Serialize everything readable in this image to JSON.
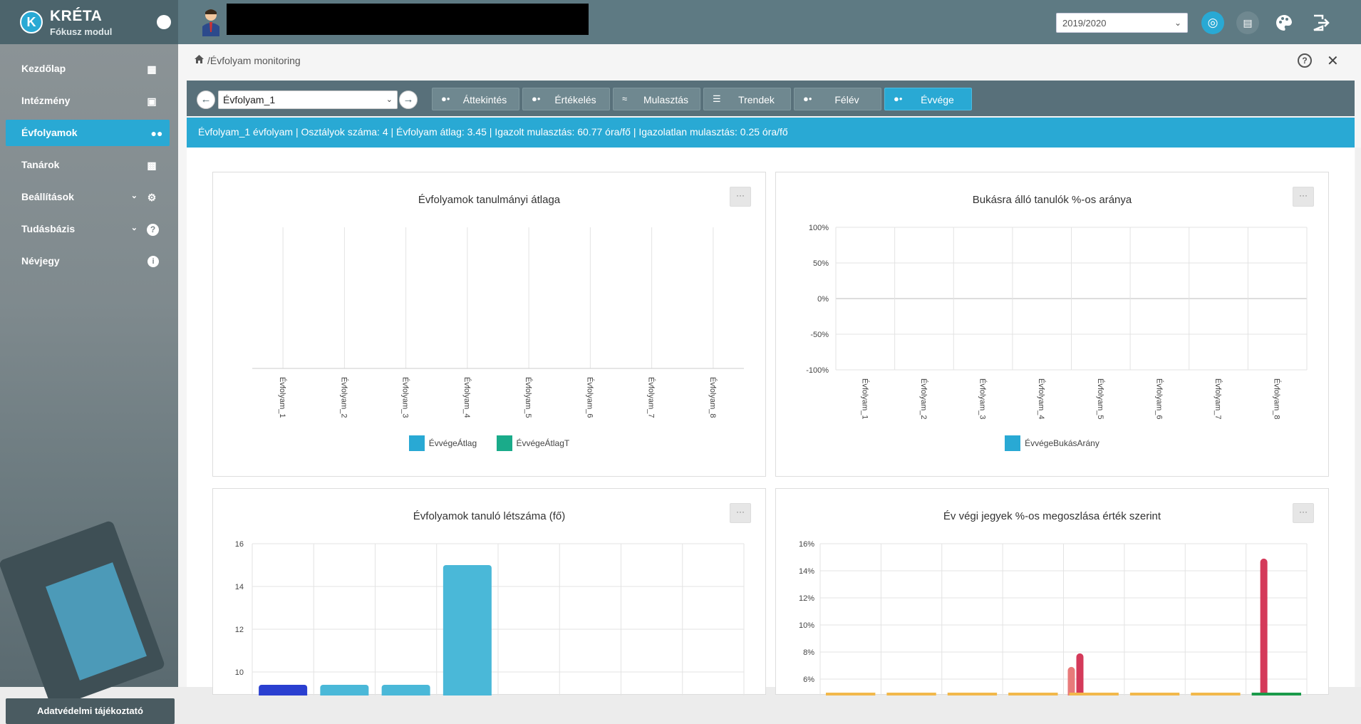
{
  "app": {
    "logo_letter": "K",
    "name": "KRÉTA",
    "module": "Fókusz modul"
  },
  "topbar": {
    "school_year": "2019/2020",
    "icons": [
      "eye-icon",
      "card-icon",
      "palette-icon",
      "logout-icon"
    ]
  },
  "sidebar": {
    "items": [
      {
        "label": "Kezdőlap",
        "icon": "dashboard-icon"
      },
      {
        "label": "Intézmény",
        "icon": "building-icon"
      },
      {
        "label": "Évfolyamok",
        "icon": "group-icon"
      },
      {
        "label": "Tanárok",
        "icon": "contact-card-icon"
      },
      {
        "label": "Beállítások",
        "icon": "gear-icon"
      },
      {
        "label": "Tudásbázis",
        "icon": "help-icon"
      },
      {
        "label": "Névjegy",
        "icon": "info-icon"
      }
    ],
    "privacy_label": "Adatvédelmi tájékoztató"
  },
  "breadcrumb": {
    "separator": "/",
    "current": "Évfolyam monitoring"
  },
  "toolbar": {
    "selected_grade": "Évfolyam_1",
    "tabs": [
      {
        "label": "Áttekintés"
      },
      {
        "label": "Értékelés"
      },
      {
        "label": "Mulasztás"
      },
      {
        "label": "Trendek"
      },
      {
        "label": "Félév"
      },
      {
        "label": "Évvége"
      }
    ],
    "active_tab": "Évvége"
  },
  "infobar": {
    "text": "Évfolyam_1 évfolyam | Osztályok száma: 4 | Évfolyam átlag: 3.45 | Igazolt mulasztás: 60.77 óra/fő | Igazolatlan mulasztás: 0.25 óra/fő"
  },
  "colors": {
    "accent": "#29a9d4",
    "teal": "#1aab8a",
    "bar_blue": "#4ab8d8",
    "pink": "#e05a78",
    "red": "#d43a5a",
    "orange": "#f2b84b"
  },
  "chart_data": [
    {
      "type": "bar",
      "title": "Évfolyamok tanulmányi átlaga",
      "categories": [
        "Évfolyam_1",
        "Évfolyam_2",
        "Évfolyam_3",
        "Évfolyam_4",
        "Évfolyam_5",
        "Évfolyam_6",
        "Évfolyam_7",
        "Évfolyam_8"
      ],
      "series": [
        {
          "name": "ÉvvégeÁtlag",
          "color": "#29a9d4",
          "values": []
        },
        {
          "name": "ÉvvégeÁtlagT",
          "color": "#1aab8a",
          "values": []
        }
      ],
      "grid": true
    },
    {
      "type": "bar",
      "title": "Bukásra álló tanulók %-os aránya",
      "categories": [
        "Évfolyam_1",
        "Évfolyam_2",
        "Évfolyam_3",
        "Évfolyam_4",
        "Évfolyam_5",
        "Évfolyam_6",
        "Évfolyam_7",
        "Évfolyam_8"
      ],
      "y_ticks": [
        "100%",
        "50%",
        "0%",
        "-50%",
        "-100%"
      ],
      "ylim": [
        -100,
        100
      ],
      "series": [
        {
          "name": "ÉvvégeBukásArány",
          "color": "#29a9d4",
          "values": []
        }
      ],
      "grid": true
    },
    {
      "type": "bar",
      "title": "Évfolyamok tanuló létszáma (fő)",
      "y_ticks": [
        "16",
        "14",
        "12",
        "10"
      ],
      "ylim": [
        9.3,
        16
      ],
      "bars": [
        {
          "value": 9.4,
          "color": "#2a3fd0"
        },
        {
          "value": 9.4,
          "color": "#4ab8d8"
        },
        {
          "value": 9.4,
          "color": "#4ab8d8"
        },
        {
          "value": 15,
          "color": "#4ab8d8"
        }
      ],
      "grid": true
    },
    {
      "type": "bar",
      "title": "Év végi jegyek %-os megoszlása érték szerint",
      "y_ticks": [
        "16%",
        "14%",
        "12%",
        "10%",
        "8%",
        "6%"
      ],
      "ylim": [
        5.5,
        16
      ],
      "bars": [
        {
          "group": 4,
          "value": 6.9,
          "color": "#e87a7a"
        },
        {
          "group": 4,
          "value": 7.9,
          "color": "#d43a5a"
        },
        {
          "group": 7,
          "value": 14.9,
          "color": "#d43a5a"
        }
      ],
      "baseline_colors": [
        "#f2b84b",
        "#f2b84b",
        "#f2b84b",
        "#f2b84b",
        "#f2b84b",
        "#f2b84b",
        "#f2b84b",
        "#1a9a4a"
      ],
      "grid": true
    }
  ]
}
